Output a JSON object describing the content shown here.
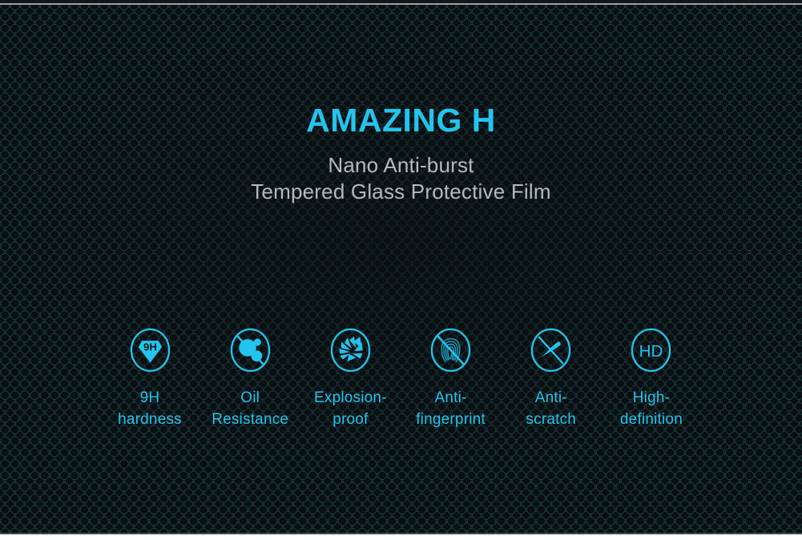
{
  "banner": {
    "title": "AMAZING H",
    "subtitle_line1": "Nano Anti-burst",
    "subtitle_line2": "Tempered Glass Protective Film",
    "colors": {
      "accent_cyan": "#22c5ed",
      "subtitle_gray": "#b5babb",
      "background_dark": "#0d1416",
      "hex_outline": "#1c4046"
    }
  },
  "features": [
    {
      "icon": "9h-diamond-icon",
      "icon_text": "9H",
      "label_line1": "9H",
      "label_line2": "hardness"
    },
    {
      "icon": "oil-droplet-blocked-icon",
      "icon_text": "",
      "label_line1": "Oil",
      "label_line2": "Resistance"
    },
    {
      "icon": "shatter-burst-icon",
      "icon_text": "",
      "label_line1": "Explosion-",
      "label_line2": "proof"
    },
    {
      "icon": "fingerprint-blocked-icon",
      "icon_text": "",
      "label_line1": "Anti-",
      "label_line2": "fingerprint"
    },
    {
      "icon": "knife-scratch-blocked-icon",
      "icon_text": "",
      "label_line1": "Anti-",
      "label_line2": "scratch"
    },
    {
      "icon": "hd-icon",
      "icon_text": "HD",
      "label_line1": "High-",
      "label_line2": "definition"
    }
  ]
}
